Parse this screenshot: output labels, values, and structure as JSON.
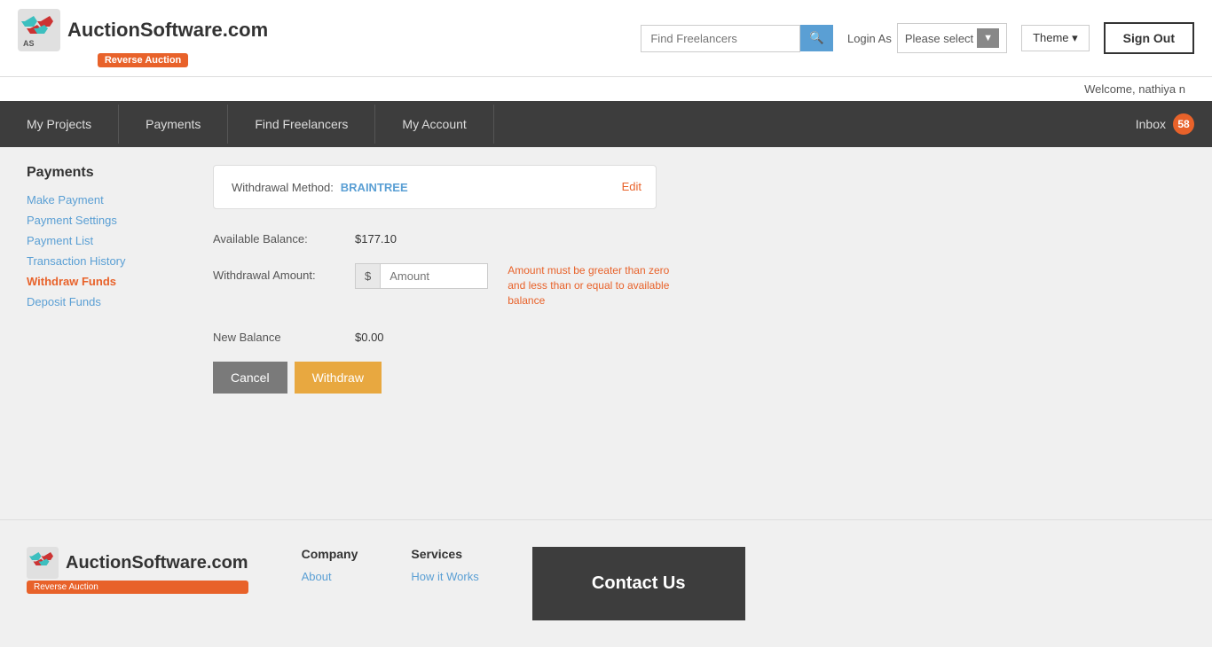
{
  "header": {
    "logo_title": "AuctionSoftware.com",
    "reverse_auction": "Reverse Auction",
    "search_placeholder": "Find Freelancers",
    "login_as_label": "Login As",
    "please_select": "Please select",
    "theme_label": "Theme ▾",
    "sign_out": "Sign Out"
  },
  "welcome": {
    "text": "Welcome, nathiya n"
  },
  "navbar": {
    "items": [
      {
        "label": "My Projects",
        "key": "my-projects"
      },
      {
        "label": "Payments",
        "key": "payments"
      },
      {
        "label": "Find Freelancers",
        "key": "find-freelancers"
      },
      {
        "label": "My Account",
        "key": "my-account"
      }
    ],
    "inbox_label": "Inbox",
    "inbox_count": "58"
  },
  "sidebar": {
    "title": "Payments",
    "links": [
      {
        "label": "Make Payment",
        "active": false
      },
      {
        "label": "Payment Settings",
        "active": false
      },
      {
        "label": "Payment List",
        "active": false
      },
      {
        "label": "Transaction History",
        "active": false
      },
      {
        "label": "Withdraw Funds",
        "active": true
      },
      {
        "label": "Deposit Funds",
        "active": false
      }
    ]
  },
  "withdrawal": {
    "method_label": "Withdrawal Method:",
    "method_value": "BRAINTREE",
    "edit_label": "Edit",
    "available_balance_label": "Available Balance:",
    "available_balance_value": "$177.10",
    "withdrawal_amount_label": "Withdrawal Amount:",
    "dollar_sign": "$",
    "amount_placeholder": "Amount",
    "amount_hint": "Amount must be greater than zero and less than or equal to available balance",
    "new_balance_label": "New Balance",
    "new_balance_value": "$0.00",
    "cancel_label": "Cancel",
    "withdraw_label": "Withdraw"
  },
  "footer": {
    "logo_title": "AuctionSoftware.com",
    "reverse_auction": "Reverse Auction",
    "company_heading": "Company",
    "company_links": [
      "About"
    ],
    "services_heading": "Services",
    "services_links": [
      "How it Works"
    ],
    "contact_us": "Contact Us"
  }
}
